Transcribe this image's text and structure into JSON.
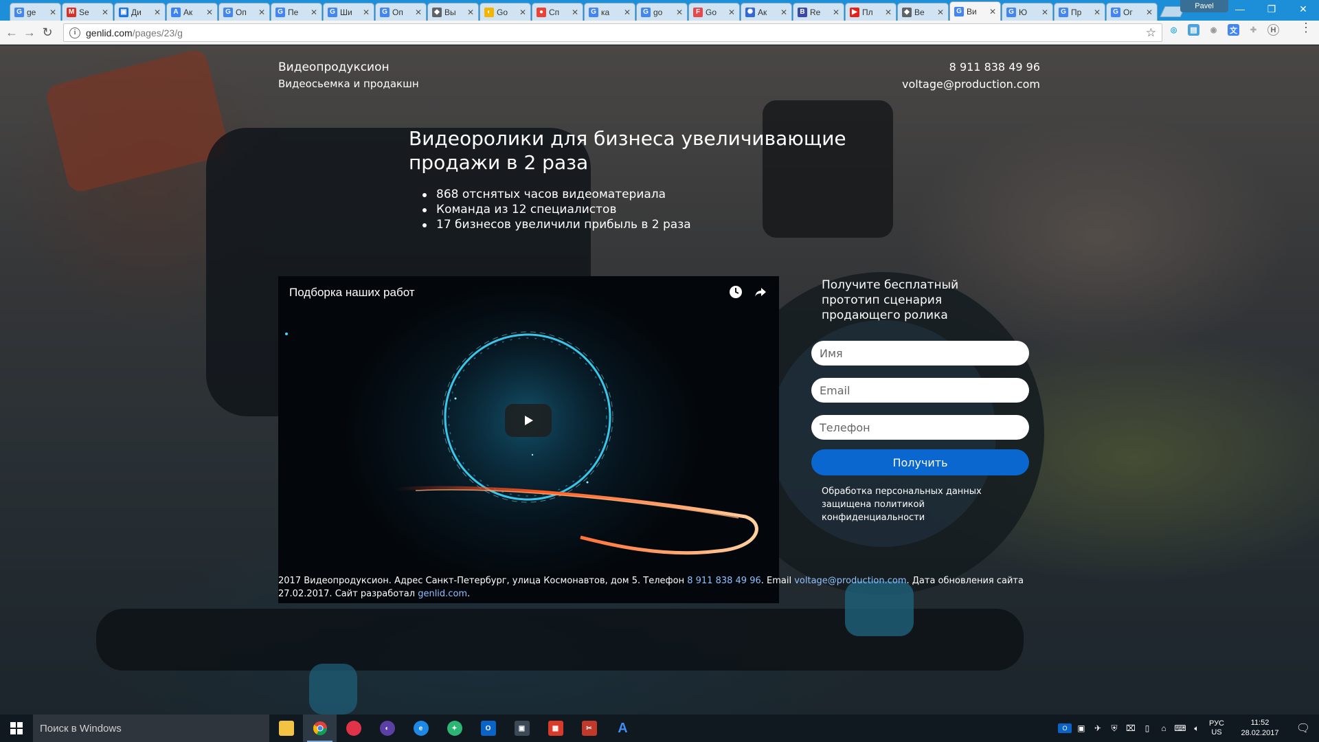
{
  "browser": {
    "tabs": [
      {
        "label": "ge",
        "icon": "google-icon",
        "color": "#4285f4",
        "glyph": "G"
      },
      {
        "label": "Se",
        "icon": "gmail-icon",
        "color": "#d93025",
        "glyph": "M"
      },
      {
        "label": "Ди",
        "icon": "chat-icon",
        "color": "#1a73e8",
        "glyph": "▣"
      },
      {
        "label": "Ак",
        "icon": "adwords-icon",
        "color": "#3b82f6",
        "glyph": "A"
      },
      {
        "label": "Оп",
        "icon": "google-icon",
        "color": "#4285f4",
        "glyph": "G"
      },
      {
        "label": "Пе",
        "icon": "google-icon",
        "color": "#4285f4",
        "glyph": "G"
      },
      {
        "label": "Ши",
        "icon": "google-icon",
        "color": "#4285f4",
        "glyph": "G"
      },
      {
        "label": "Оп",
        "icon": "google-icon",
        "color": "#4285f4",
        "glyph": "G"
      },
      {
        "label": "Вы",
        "icon": "extension-icon",
        "color": "#5f6368",
        "glyph": "◆"
      },
      {
        "label": "Go",
        "icon": "drive-icon",
        "color": "#f4b400",
        "glyph": "◐"
      },
      {
        "label": "Сп",
        "icon": "maps-icon",
        "color": "#ea4335",
        "glyph": "●"
      },
      {
        "label": "ка",
        "icon": "google-icon",
        "color": "#4285f4",
        "glyph": "G"
      },
      {
        "label": "go",
        "icon": "google-icon",
        "color": "#4285f4",
        "glyph": "G"
      },
      {
        "label": "Go",
        "icon": "app-icon",
        "color": "#e5484d",
        "glyph": "F"
      },
      {
        "label": "Ак",
        "icon": "analytics-icon",
        "color": "#3367d6",
        "glyph": "✺"
      },
      {
        "label": "Re",
        "icon": "b-icon",
        "color": "#3949ab",
        "glyph": "B"
      },
      {
        "label": "Пл",
        "icon": "youtube-icon",
        "color": "#e62117",
        "glyph": "▶"
      },
      {
        "label": "Ве",
        "icon": "extension-icon",
        "color": "#5f6368",
        "glyph": "◆"
      },
      {
        "label": "Ви",
        "icon": "google-icon",
        "color": "#4285f4",
        "glyph": "G",
        "active": true
      },
      {
        "label": "Ю",
        "icon": "google-icon",
        "color": "#4285f4",
        "glyph": "G"
      },
      {
        "label": "Пр",
        "icon": "google-icon",
        "color": "#4285f4",
        "glyph": "G"
      },
      {
        "label": "Ог",
        "icon": "google-icon",
        "color": "#4285f4",
        "glyph": "G"
      }
    ],
    "profile_name": "Pavel",
    "url_host": "genlid.com",
    "url_path": "/pages/23/g"
  },
  "page": {
    "brand_line1": "Видеопродуксион",
    "brand_line2": "Видеосьемка и продакшн",
    "phone": "8 911 838 49 96",
    "email": "voltage@production.com",
    "headline": "Видеоролики для бизнеса увеличивающие продажи в 2 раза",
    "bullets": [
      "868 отснятых часов видеоматериала",
      "Команда из 12 специалистов",
      "17 бизнесов увеличили прибыль в 2 раза"
    ],
    "video_title": "Подборка наших работ",
    "form_title": "Получите бесплатный прототип сценария продающего ролика",
    "name_placeholder": "Имя",
    "email_placeholder": "Email",
    "phone_placeholder": "Телефон",
    "submit_label": "Получить",
    "policy_text": "Обработка персональных данных защищена политикой конфиденциальности",
    "footer": {
      "part1": "2017 Видеопродуксион. Адрес Санкт-Петербург, улица Космонавтов, дом 5. Телефон ",
      "phone_link": "8 911 838 49 96",
      "part2": ". Email ",
      "email_link": "voltage@production.com",
      "part3": ". Дата обновления сайта 27.02.2017. Сайт разработал ",
      "site_link": "genlid.com",
      "part4": "."
    }
  },
  "taskbar": {
    "search_placeholder": "Поиск в Windows",
    "lang_line1": "РУС",
    "lang_line2": "US",
    "time": "11:52",
    "date": "28.02.2017"
  },
  "colors": {
    "accent_button": "#0a67cf",
    "tabstrip": "#1d8fd8",
    "footer_link": "#8fc0ff"
  }
}
